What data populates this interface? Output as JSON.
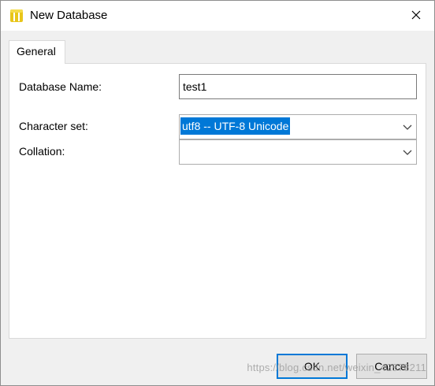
{
  "window": {
    "title": "New Database",
    "close_icon": "close-icon",
    "app_icon": "database-icon"
  },
  "tabs": [
    {
      "label": "General",
      "active": true
    }
  ],
  "form": {
    "database_name": {
      "label": "Database Name:",
      "value": "test1"
    },
    "character_set": {
      "label": "Character set:",
      "value": "utf8 -- UTF-8 Unicode"
    },
    "collation": {
      "label": "Collation:",
      "value": ""
    }
  },
  "buttons": {
    "ok": "OK",
    "cancel": "Cancel"
  },
  "watermark": "https://blog.csdn.net/weixin_42878211",
  "colors": {
    "selection": "#0078d7",
    "default_button_border": "#0078d7",
    "icon_yellow": "#e8c51a"
  }
}
